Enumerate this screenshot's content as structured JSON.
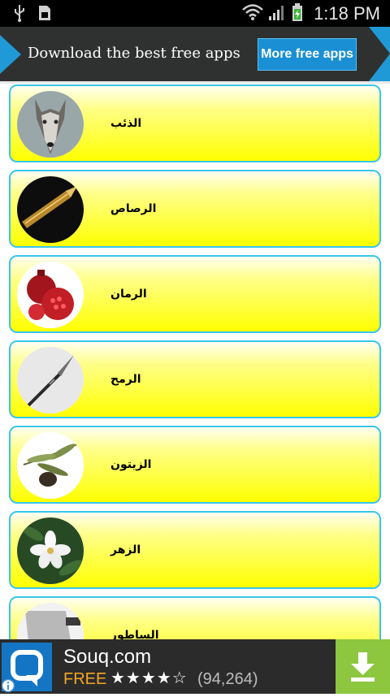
{
  "status_bar": {
    "time": "1:18 PM",
    "icons": [
      "usb-icon",
      "sd-card-icon",
      "wifi-icon",
      "signal-icon",
      "battery-icon"
    ]
  },
  "banner": {
    "text": "Download the best free apps",
    "button_label": "More free apps"
  },
  "items": [
    {
      "label": "الذئب",
      "icon": "wolf-image"
    },
    {
      "label": "الرصاص",
      "icon": "bullet-image"
    },
    {
      "label": "الرمان",
      "icon": "pomegranate-image"
    },
    {
      "label": "الرمح",
      "icon": "spear-image"
    },
    {
      "label": "الزيتون",
      "icon": "olive-image"
    },
    {
      "label": "الزهر",
      "icon": "flower-image"
    },
    {
      "label": "الساطور",
      "icon": "cleaver-image"
    }
  ],
  "ad": {
    "app_name": "Souq.com",
    "price": "FREE",
    "stars": "★★★★☆",
    "rating_count": "(94,264)"
  },
  "colors": {
    "item_border": "#39c6ea",
    "item_fill": "#ffff00",
    "banner_button": "#1a8fd3",
    "download_button": "#8dc63f",
    "price": "#f5a623"
  }
}
